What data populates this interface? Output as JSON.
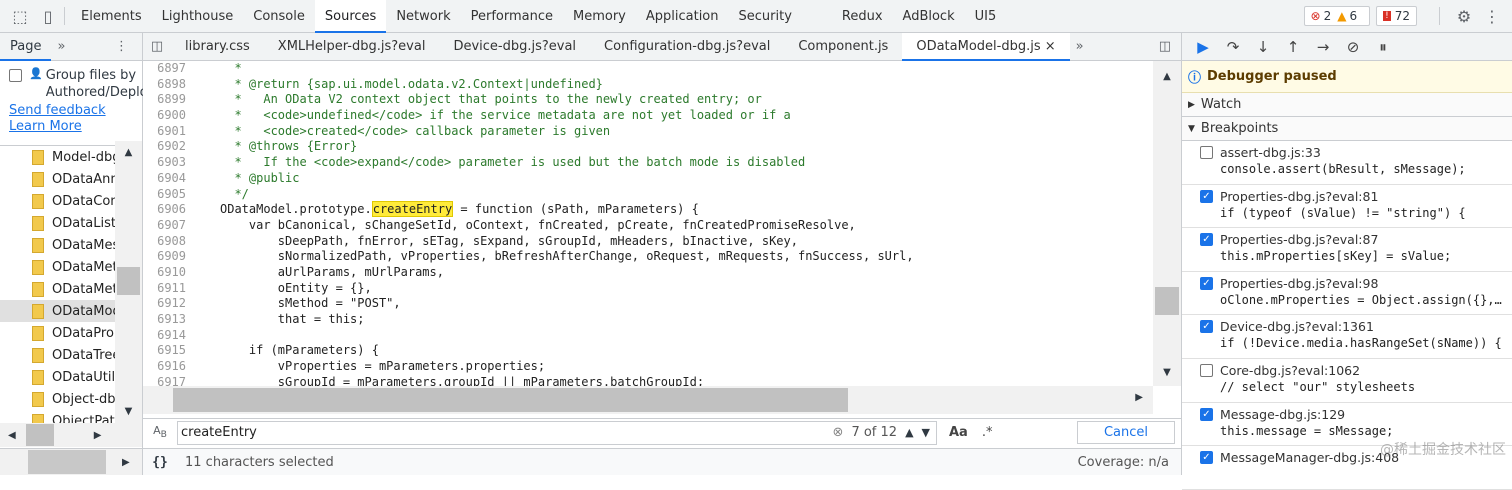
{
  "toolbar": {
    "tabs": [
      "Elements",
      "Lighthouse",
      "Console",
      "Sources",
      "Network",
      "Performance",
      "Memory",
      "Application",
      "Security",
      "Redux",
      "AdBlock",
      "UI5"
    ],
    "active_tab": "Sources",
    "errors": "2",
    "warnings": "6",
    "issues": "72"
  },
  "navigator": {
    "tab": "Page",
    "group_label_1": "Group files by",
    "group_label_2": "Authored/Deploy",
    "send_feedback": "Send feedback",
    "learn_more": "Learn More",
    "files": [
      "Model-dbg",
      "ODataAnn",
      "ODataCon",
      "ODataListB",
      "ODataMes",
      "ODataMet",
      "ODataMet",
      "ODataMod",
      "ODataProp",
      "ODataTree",
      "ODataUtils",
      "Object-dbg",
      "ObjectPath"
    ]
  },
  "editor": {
    "tabs": [
      "library.css",
      "XMLHelper-dbg.js?eval",
      "Device-dbg.js?eval",
      "Configuration-dbg.js?eval",
      "Component.js",
      "ODataModel-dbg.js"
    ],
    "active_tab": "ODataModel-dbg.js",
    "lines": [
      {
        "n": "6897",
        "pre": "  *",
        "hl": "",
        "post": "",
        "comment": true
      },
      {
        "n": "6898",
        "pre": "  * @return {sap.ui.model.odata.v2.Context|undefined}",
        "hl": "",
        "post": "",
        "comment": true
      },
      {
        "n": "6899",
        "pre": "  *   An OData V2 context object that points to the newly created entry; or",
        "hl": "",
        "post": "",
        "comment": true
      },
      {
        "n": "6900",
        "pre": "  *   <code>undefined</code> if the service metadata are not yet loaded or if a",
        "hl": "",
        "post": "",
        "comment": true
      },
      {
        "n": "6901",
        "pre": "  *   <code>created</code> callback parameter is given",
        "hl": "",
        "post": "",
        "comment": true
      },
      {
        "n": "6902",
        "pre": "  * @throws {Error}",
        "hl": "",
        "post": "",
        "comment": true
      },
      {
        "n": "6903",
        "pre": "  *   If the <code>expand</code> parameter is used but the batch mode is disabled",
        "hl": "",
        "post": "",
        "comment": true
      },
      {
        "n": "6904",
        "pre": "  * @public",
        "hl": "",
        "post": "",
        "comment": true
      },
      {
        "n": "6905",
        "pre": "  */",
        "hl": "",
        "post": "",
        "comment": true
      },
      {
        "n": "6906",
        "pre": "ODataModel.prototype.",
        "hl": "createEntry",
        "post": " = function (sPath, mParameters) {",
        "comment": false
      },
      {
        "n": "6907",
        "pre": "    var bCanonical, sChangeSetId, oContext, fnCreated, pCreate, fnCreatedPromiseResolve,",
        "hl": "",
        "post": "",
        "comment": false
      },
      {
        "n": "6908",
        "pre": "        sDeepPath, fnError, sETag, sExpand, sGroupId, mHeaders, bInactive, sKey,",
        "hl": "",
        "post": "",
        "comment": false
      },
      {
        "n": "6909",
        "pre": "        sNormalizedPath, vProperties, bRefreshAfterChange, oRequest, mRequests, fnSuccess, sUrl,",
        "hl": "",
        "post": "",
        "comment": false
      },
      {
        "n": "6910",
        "pre": "        aUrlParams, mUrlParams,",
        "hl": "",
        "post": "",
        "comment": false
      },
      {
        "n": "6911",
        "pre": "        oEntity = {},",
        "hl": "",
        "post": "",
        "comment": false
      },
      {
        "n": "6912",
        "pre": "        sMethod = \"POST\",",
        "hl": "",
        "post": "",
        "comment": false
      },
      {
        "n": "6913",
        "pre": "        that = this;",
        "hl": "",
        "post": "",
        "comment": false
      },
      {
        "n": "6914",
        "pre": "",
        "hl": "",
        "post": "",
        "comment": false
      },
      {
        "n": "6915",
        "pre": "    if (mParameters) {",
        "hl": "",
        "post": "",
        "comment": false
      },
      {
        "n": "6916",
        "pre": "        vProperties = mParameters.properties;",
        "hl": "",
        "post": "",
        "comment": false
      },
      {
        "n": "6917",
        "pre": "        sGroupId = mParameters.groupId || mParameters.batchGroupId;",
        "hl": "",
        "post": "",
        "comment": false
      }
    ]
  },
  "search": {
    "value": "createEntry",
    "match": "7 of 12",
    "case_label": "Aa",
    "regex_label": ".*",
    "cancel": "Cancel"
  },
  "status": {
    "selected": "11 characters selected",
    "coverage": "Coverage: n/a",
    "braces": "{}"
  },
  "debugger": {
    "paused": "Debugger paused",
    "watch": "Watch",
    "breakpoints_label": "Breakpoints",
    "breakpoints": [
      {
        "file": "assert-dbg.js:33",
        "code": "console.assert(bResult, sMessage);",
        "checked": false
      },
      {
        "file": "Properties-dbg.js?eval:81",
        "code": "if (typeof (sValue) != \"string\") {",
        "checked": true
      },
      {
        "file": "Properties-dbg.js?eval:87",
        "code": "this.mProperties[sKey] = sValue;",
        "checked": true
      },
      {
        "file": "Properties-dbg.js?eval:98",
        "code": "oClone.mProperties = Object.assign({},…",
        "checked": true
      },
      {
        "file": "Device-dbg.js?eval:1361",
        "code": "if (!Device.media.hasRangeSet(sName)) {",
        "checked": true
      },
      {
        "file": "Core-dbg.js?eval:1062",
        "code": "// select \"our\" stylesheets",
        "checked": false
      },
      {
        "file": "Message-dbg.js:129",
        "code": "this.message = sMessage;",
        "checked": true
      },
      {
        "file": "MessageManager-dbg.js:408",
        "code": "",
        "checked": true
      }
    ]
  },
  "watermark": "@稀土掘金技术社区"
}
